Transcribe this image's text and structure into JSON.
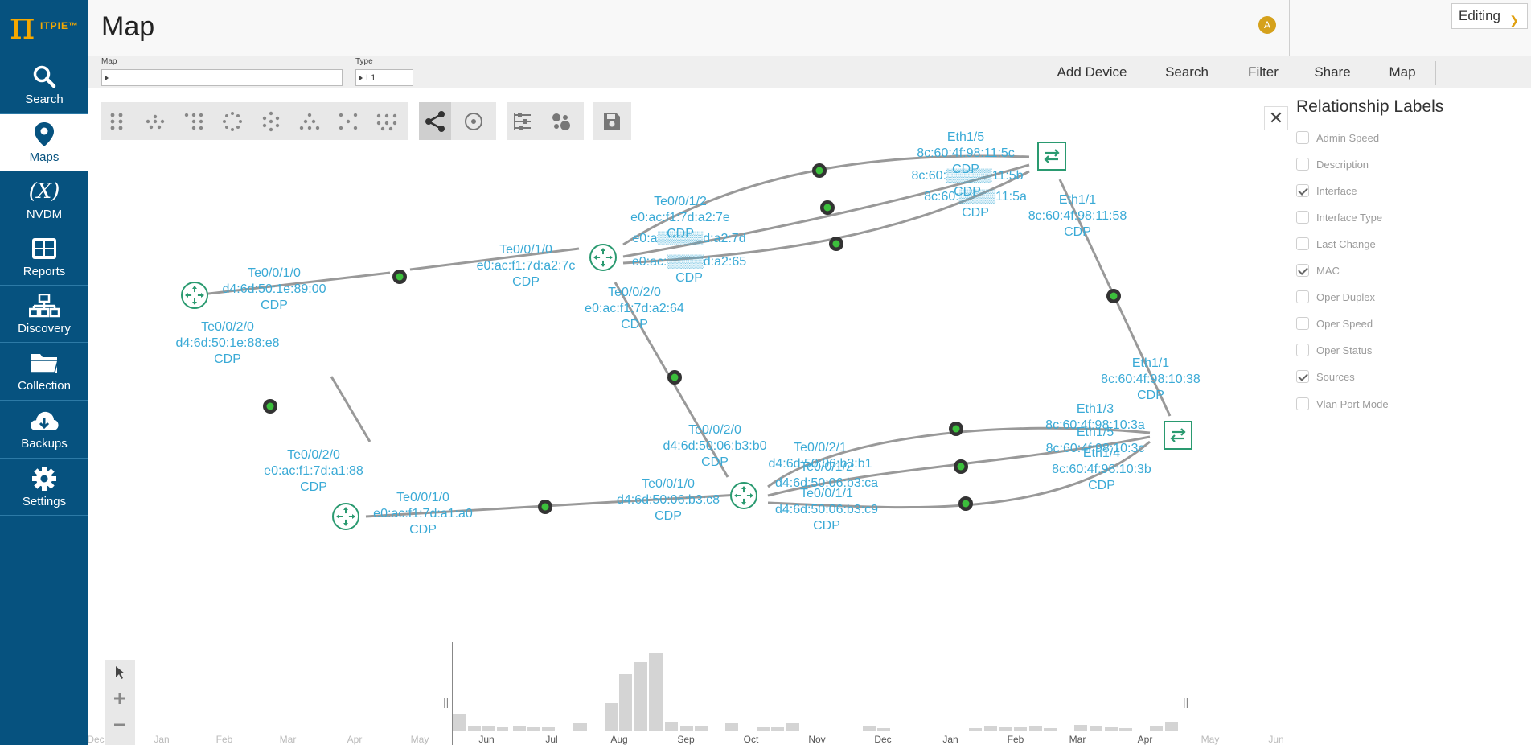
{
  "brand": {
    "pi": "π",
    "name": "ITPIE™",
    "accent": "#f5a800",
    "sidebar_bg": "#06527f"
  },
  "sidebar": {
    "items": [
      {
        "label": "Search",
        "icon": "search-icon"
      },
      {
        "label": "Maps",
        "icon": "map-pin-icon",
        "active": true
      },
      {
        "label": "NVDM",
        "icon": "variable-icon",
        "glyph": "(X)"
      },
      {
        "label": "Reports",
        "icon": "table-icon"
      },
      {
        "label": "Discovery",
        "icon": "network-icon"
      },
      {
        "label": "Collection",
        "icon": "folder-icon"
      },
      {
        "label": "Backups",
        "icon": "cloud-download-icon"
      },
      {
        "label": "Settings",
        "icon": "gear-icon"
      }
    ]
  },
  "header": {
    "title": "Map",
    "avatar": "A"
  },
  "toolbar": {
    "map_label": "Map",
    "map_value": "",
    "type_label": "Type",
    "type_value": "L1",
    "buttons": [
      "Add Device",
      "Search",
      "Filter",
      "Share",
      "Map"
    ],
    "mode": "Editing"
  },
  "graph": {
    "labels": [
      {
        "l1": "Te0/0/1/0",
        "l2": "d4:6d:50:1e:89:00",
        "l3": "CDP"
      },
      {
        "l1": "Te0/0/2/0",
        "l2": "d4:6d:50:1e:88:e8",
        "l3": "CDP"
      },
      {
        "l1": "Te0/0/1/0",
        "l2": "e0:ac:f1:7d:a2:7c",
        "l3": "CDP"
      },
      {
        "l1": "Te0/0/1/2",
        "l2": "e0:ac:f1:7d:a2:7e",
        "l3": "CDP"
      },
      {
        "l1": "",
        "l2": "e0:a▒▒▒▒▒d:a2:7d",
        "l3": ""
      },
      {
        "l1": "",
        "l2": "e0:ac:▒▒▒▒d:a2:65",
        "l3": "CDP"
      },
      {
        "l1": "Te0/0/2/0",
        "l2": "e0:ac:f1:7d:a2:64",
        "l3": "CDP"
      },
      {
        "l1": "Eth1/5",
        "l2": "8c:60:4f:98:11:5c",
        "l3": "CDP"
      },
      {
        "l1": "",
        "l2": "8c:60:▒▒▒▒▒11:5b",
        "l3": "CDP"
      },
      {
        "l1": "",
        "l2": "8c:60:▒▒▒▒11:5a",
        "l3": "CDP"
      },
      {
        "l1": "Eth1/1",
        "l2": "8c:60:4f:98:11:58",
        "l3": "CDP"
      },
      {
        "l1": "Eth1/1",
        "l2": "8c:60:4f:98:10:38",
        "l3": "CDP"
      },
      {
        "l1": "Eth1/3",
        "l2": "8c:60:4f:98:10:3a",
        "l3": ""
      },
      {
        "l1": "Eth1/5",
        "l2": "8c:60:4f:98:10:3c",
        "l3": ""
      },
      {
        "l1": "Eth1/4",
        "l2": "8c:60:4f:98:10:3b",
        "l3": "CDP"
      },
      {
        "l1": "Te0/0/2/0",
        "l2": "d4:6d:50:06:b3:b0",
        "l3": "CDP"
      },
      {
        "l1": "Te0/0/2/1",
        "l2": "d4:6d:50:06:b3:b1",
        "l3": ""
      },
      {
        "l1": "Te0/0/1/2",
        "l2": "d4:6d:50:06:b3:ca",
        "l3": ""
      },
      {
        "l1": "Te0/0/1/1",
        "l2": "d4:6d:50:06:b3:c9",
        "l3": "CDP"
      },
      {
        "l1": "Te0/0/1/0",
        "l2": "d4:6d:50:06:b3:c8",
        "l3": "CDP"
      },
      {
        "l1": "Te0/0/1/0",
        "l2": "e0:ac:f1:7d:a1:a0",
        "l3": "CDP"
      },
      {
        "l1": "Te0/0/2/0",
        "l2": "e0:ac:f1:7d:a1:88",
        "l3": "CDP"
      }
    ]
  },
  "relationship_labels": {
    "title": "Relationship Labels",
    "options": [
      {
        "label": "Admin Speed",
        "checked": false
      },
      {
        "label": "Description",
        "checked": false
      },
      {
        "label": "Interface",
        "checked": true
      },
      {
        "label": "Interface Type",
        "checked": false
      },
      {
        "label": "Last Change",
        "checked": false
      },
      {
        "label": "MAC",
        "checked": true
      },
      {
        "label": "Oper Duplex",
        "checked": false
      },
      {
        "label": "Oper Speed",
        "checked": false
      },
      {
        "label": "Oper Status",
        "checked": false
      },
      {
        "label": "Sources",
        "checked": true
      },
      {
        "label": "Vlan Port Mode",
        "checked": false
      }
    ]
  },
  "timeline": {
    "months": [
      "Dec",
      "Jan",
      "Feb",
      "Mar",
      "Apr",
      "May",
      "Jun",
      "Jul",
      "Aug",
      "Sep",
      "Oct",
      "Nov",
      "Dec",
      "Jan",
      "Feb",
      "Mar",
      "Apr",
      "May",
      "Jun"
    ]
  }
}
